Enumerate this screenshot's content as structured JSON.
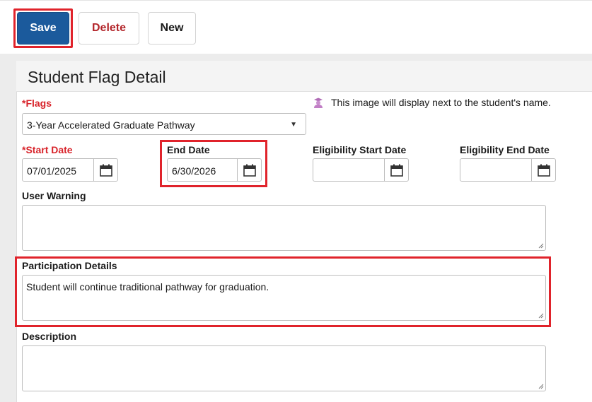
{
  "toolbar": {
    "save_label": "Save",
    "delete_label": "Delete",
    "new_label": "New"
  },
  "panel": {
    "title": "Student Flag Detail"
  },
  "flags": {
    "required_mark": "*",
    "label": "Flags",
    "selected": "3-Year Accelerated Graduate Pathway",
    "note": "This image will display next to the student's name."
  },
  "dates": {
    "start": {
      "required_mark": "*",
      "label": "Start Date",
      "value": "07/01/2025"
    },
    "end": {
      "label": "End Date",
      "value": "6/30/2026"
    },
    "eligibility_start": {
      "label": "Eligibility Start Date",
      "value": ""
    },
    "eligibility_end": {
      "label": "Eligibility End Date",
      "value": ""
    }
  },
  "user_warning": {
    "label": "User Warning",
    "value": ""
  },
  "participation": {
    "label": "Participation Details",
    "value": "Student will continue traditional pathway for graduation."
  },
  "description": {
    "label": "Description",
    "value": ""
  },
  "colors": {
    "primary": "#1b5a9c",
    "required": "#d8232a",
    "highlight": "#e0232b",
    "flag_icon": "#c27fc6"
  },
  "icons": {
    "calendar": "calendar-icon",
    "flag_image": "student-flag-icon",
    "dropdown": "chevron-down-icon",
    "resize": "resize-grip-icon"
  }
}
